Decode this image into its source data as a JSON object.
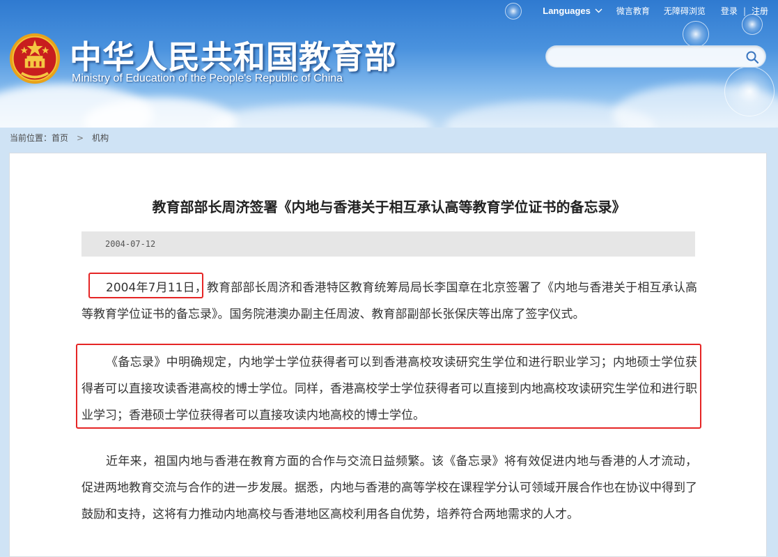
{
  "header": {
    "site_title": "中华人民共和国教育部",
    "site_subtitle": "Ministry of Education of the People's Republic of China",
    "nav": {
      "languages": "Languages",
      "weibo": "微言教育",
      "accessible": "无障碍浏览",
      "login": "登录",
      "separator": "|",
      "register": "注册"
    },
    "search": {
      "value": "",
      "icon": "search-icon"
    },
    "emblem_icon": "national-emblem-icon"
  },
  "breadcrumb": {
    "label": "当前位置：",
    "home": "首页",
    "separator": ">",
    "current": "机构"
  },
  "article": {
    "title": "教育部部长周济签署《内地与香港关于相互承认高等教育学位证书的备忘录》",
    "date": "2004-07-12",
    "paragraphs": {
      "p1": "2004年7月11日，教育部部长周济和香港特区教育统筹局局长李国章在北京签署了《内地与香港关于相互承认高等教育学位证书的备忘录》。国务院港澳办副主任周波、教育部副部长张保庆等出席了签字仪式。",
      "p2": "《备忘录》中明确规定，内地学士学位获得者可以到香港高校攻读研究生学位和进行职业学习；内地硕士学位获得者可以直接攻读香港高校的博士学位。同样，香港高校学士学位获得者可以直接到内地高校攻读研究生学位和进行职业学习；香港硕士学位获得者可以直接攻读内地高校的博士学位。",
      "p3": "近年来，祖国内地与香港在教育方面的合作与交流日益频繁。该《备忘录》将有效促进内地与香港的人才流动，促进两地教育交流与合作的进一步发展。据悉，内地与香港的高等学校在课程学分认可领域开展合作也在协议中得到了鼓励和支持，这将有力推动内地高校与香港地区高校利用各自优势，培养符合两地需求的人才。"
    }
  },
  "colors": {
    "highlight_border": "#e52525",
    "banner_blue": "#2f7ad0",
    "date_bar": "#e6e6e6"
  }
}
